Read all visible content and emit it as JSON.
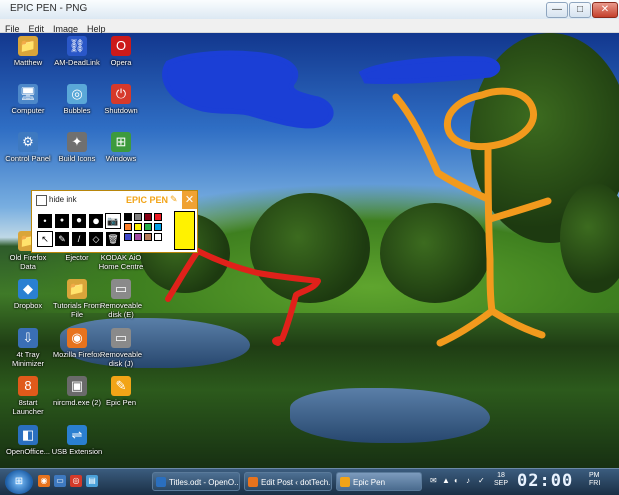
{
  "window": {
    "title": "EPIC PEN - PNG",
    "min": "—",
    "max": "□",
    "close": "✕"
  },
  "menu": [
    "File",
    "Edit",
    "Image",
    "Help"
  ],
  "desktop_icons": [
    {
      "label": "Matthew",
      "color": "#d9a53a",
      "glyph": "📁"
    },
    {
      "label": "AM-DeadLink",
      "color": "#2a57c8",
      "glyph": "⛓"
    },
    {
      "label": "Opera",
      "color": "#cc1a1a",
      "glyph": "O"
    },
    {
      "label": "Computer",
      "color": "#4d88c9",
      "glyph": "🖥"
    },
    {
      "label": "Bubbles",
      "color": "#5aa8d8",
      "glyph": "◎"
    },
    {
      "label": "Shutdown",
      "color": "#d6392a",
      "glyph": "⏻"
    },
    {
      "label": "Control Panel",
      "color": "#3e79c0",
      "glyph": "⚙"
    },
    {
      "label": "Build Icons",
      "color": "#707070",
      "glyph": "✦"
    },
    {
      "label": "Windows",
      "color": "#3d9a3d",
      "glyph": "⊞"
    },
    {
      "label": "Old Firefox Data",
      "color": "#d9a53a",
      "glyph": "📁"
    },
    {
      "label": "Ejector",
      "color": "#4aa0d8",
      "glyph": "⏏"
    },
    {
      "label": "KODAK AiO Home Centre",
      "color": "#d33a2a",
      "glyph": "K"
    },
    {
      "label": "Dropbox",
      "color": "#2a80d2",
      "glyph": "◆"
    },
    {
      "label": "Tutorials From File",
      "color": "#d9a53a",
      "glyph": "📁"
    },
    {
      "label": "Removeable disk (E)",
      "color": "#8a8a8a",
      "glyph": "▭"
    },
    {
      "label": "4t Tray Minimizer",
      "color": "#3a6fb5",
      "glyph": "⇩"
    },
    {
      "label": "Mozilla Firefox",
      "color": "#e8731d",
      "glyph": "◉"
    },
    {
      "label": "Removeable disk (J)",
      "color": "#8a8a8a",
      "glyph": "▭"
    },
    {
      "label": "8start Launcher",
      "color": "#e05a1a",
      "glyph": "8"
    },
    {
      "label": "nircmd.exe (2)",
      "color": "#6a6a6a",
      "glyph": "▣"
    },
    {
      "label": "Epic Pen",
      "color": "#f2a417",
      "glyph": "✎"
    },
    {
      "label": "OpenOffice...",
      "color": "#2a6fbf",
      "glyph": "◧"
    },
    {
      "label": "USB Extension",
      "color": "#2a7fd0",
      "glyph": "⇌"
    }
  ],
  "epic_pen": {
    "hide_ink_label": "hide ink",
    "brand": "EPIC PEN",
    "pencil_glyph": "✎",
    "close_glyph": "✕",
    "brush_sizes": [
      "•",
      "●",
      "●",
      "●"
    ],
    "tools": [
      "cursor-icon",
      "pen-icon",
      "highlighter-icon",
      "eraser-icon",
      "trash-icon"
    ],
    "tool_glyphs": [
      "↖",
      "✎",
      "/",
      "◇",
      "🗑"
    ],
    "camera_glyph": "📷",
    "palette": [
      "#000000",
      "#7f7f7f",
      "#880015",
      "#ed1c24",
      "#ff7f27",
      "#fff200",
      "#22b14c",
      "#00a2e8",
      "#3f48cc",
      "#a349a4",
      "#b97a57",
      "#ffffff"
    ],
    "current_color": "#fff200"
  },
  "taskbar": {
    "start_glyph": "⊞",
    "quick_launch": [
      {
        "color": "#e8731d",
        "glyph": "◉"
      },
      {
        "color": "#3e79c0",
        "glyph": "▭"
      },
      {
        "color": "#d33a2a",
        "glyph": "◎"
      },
      {
        "color": "#4aa0d8",
        "glyph": "▤"
      }
    ],
    "tasks": [
      {
        "label": "Titles.odt - OpenO...",
        "color": "#2a6fbf",
        "active": false
      },
      {
        "label": "Edit Post ‹ dotTech...",
        "color": "#e8731d",
        "active": false
      },
      {
        "label": "Epic Pen",
        "color": "#f2a417",
        "active": true
      }
    ],
    "tray": [
      "✉",
      "▲",
      "◐",
      "♪",
      "✓"
    ],
    "date_day": "18",
    "date_month": "SEP",
    "time": "02:00",
    "ampm": "PM",
    "weekday": "FRI"
  },
  "colors": {
    "ink_blue": "#1b3fd6",
    "ink_red": "#e0211a",
    "ink_orange": "#f29a1d"
  }
}
